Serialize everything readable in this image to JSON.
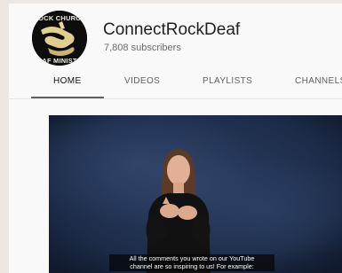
{
  "channel": {
    "avatar_text_top": "OCK CHURC",
    "avatar_text_bottom": "AF MINIST",
    "title": "ConnectRockDeaf",
    "subscribers": "7,808 subscribers"
  },
  "tabs": [
    {
      "label": "HOME",
      "active": true
    },
    {
      "label": "VIDEOS",
      "active": false
    },
    {
      "label": "PLAYLISTS",
      "active": false
    },
    {
      "label": "CHANNELS",
      "active": false
    }
  ],
  "video": {
    "caption_line1": "All the comments you wrote on our YouTube",
    "caption_line2": "channel are so inspiring to us! For example:"
  },
  "colors": {
    "page_background": "#ece7e2",
    "content_background": "#f9f9f9",
    "video_backdrop": "#1b2a46",
    "avatar_logo": "#e2cf8e"
  }
}
